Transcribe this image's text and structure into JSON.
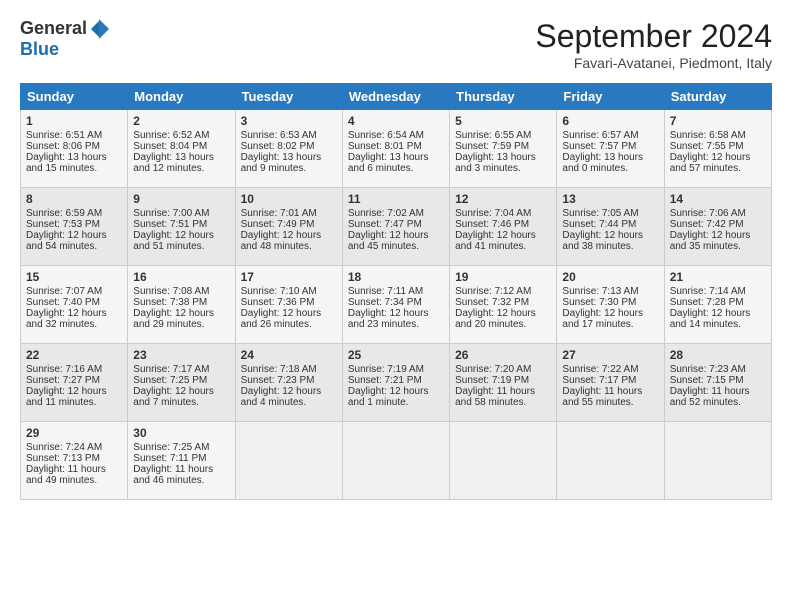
{
  "header": {
    "logo_general": "General",
    "logo_blue": "Blue",
    "title": "September 2024",
    "subtitle": "Favari-Avatanei, Piedmont, Italy"
  },
  "weekdays": [
    "Sunday",
    "Monday",
    "Tuesday",
    "Wednesday",
    "Thursday",
    "Friday",
    "Saturday"
  ],
  "weeks": [
    [
      {
        "day": "1",
        "lines": [
          "Sunrise: 6:51 AM",
          "Sunset: 8:06 PM",
          "Daylight: 13 hours",
          "and 15 minutes."
        ]
      },
      {
        "day": "2",
        "lines": [
          "Sunrise: 6:52 AM",
          "Sunset: 8:04 PM",
          "Daylight: 13 hours",
          "and 12 minutes."
        ]
      },
      {
        "day": "3",
        "lines": [
          "Sunrise: 6:53 AM",
          "Sunset: 8:02 PM",
          "Daylight: 13 hours",
          "and 9 minutes."
        ]
      },
      {
        "day": "4",
        "lines": [
          "Sunrise: 6:54 AM",
          "Sunset: 8:01 PM",
          "Daylight: 13 hours",
          "and 6 minutes."
        ]
      },
      {
        "day": "5",
        "lines": [
          "Sunrise: 6:55 AM",
          "Sunset: 7:59 PM",
          "Daylight: 13 hours",
          "and 3 minutes."
        ]
      },
      {
        "day": "6",
        "lines": [
          "Sunrise: 6:57 AM",
          "Sunset: 7:57 PM",
          "Daylight: 13 hours",
          "and 0 minutes."
        ]
      },
      {
        "day": "7",
        "lines": [
          "Sunrise: 6:58 AM",
          "Sunset: 7:55 PM",
          "Daylight: 12 hours",
          "and 57 minutes."
        ]
      }
    ],
    [
      {
        "day": "8",
        "lines": [
          "Sunrise: 6:59 AM",
          "Sunset: 7:53 PM",
          "Daylight: 12 hours",
          "and 54 minutes."
        ]
      },
      {
        "day": "9",
        "lines": [
          "Sunrise: 7:00 AM",
          "Sunset: 7:51 PM",
          "Daylight: 12 hours",
          "and 51 minutes."
        ]
      },
      {
        "day": "10",
        "lines": [
          "Sunrise: 7:01 AM",
          "Sunset: 7:49 PM",
          "Daylight: 12 hours",
          "and 48 minutes."
        ]
      },
      {
        "day": "11",
        "lines": [
          "Sunrise: 7:02 AM",
          "Sunset: 7:47 PM",
          "Daylight: 12 hours",
          "and 45 minutes."
        ]
      },
      {
        "day": "12",
        "lines": [
          "Sunrise: 7:04 AM",
          "Sunset: 7:46 PM",
          "Daylight: 12 hours",
          "and 41 minutes."
        ]
      },
      {
        "day": "13",
        "lines": [
          "Sunrise: 7:05 AM",
          "Sunset: 7:44 PM",
          "Daylight: 12 hours",
          "and 38 minutes."
        ]
      },
      {
        "day": "14",
        "lines": [
          "Sunrise: 7:06 AM",
          "Sunset: 7:42 PM",
          "Daylight: 12 hours",
          "and 35 minutes."
        ]
      }
    ],
    [
      {
        "day": "15",
        "lines": [
          "Sunrise: 7:07 AM",
          "Sunset: 7:40 PM",
          "Daylight: 12 hours",
          "and 32 minutes."
        ]
      },
      {
        "day": "16",
        "lines": [
          "Sunrise: 7:08 AM",
          "Sunset: 7:38 PM",
          "Daylight: 12 hours",
          "and 29 minutes."
        ]
      },
      {
        "day": "17",
        "lines": [
          "Sunrise: 7:10 AM",
          "Sunset: 7:36 PM",
          "Daylight: 12 hours",
          "and 26 minutes."
        ]
      },
      {
        "day": "18",
        "lines": [
          "Sunrise: 7:11 AM",
          "Sunset: 7:34 PM",
          "Daylight: 12 hours",
          "and 23 minutes."
        ]
      },
      {
        "day": "19",
        "lines": [
          "Sunrise: 7:12 AM",
          "Sunset: 7:32 PM",
          "Daylight: 12 hours",
          "and 20 minutes."
        ]
      },
      {
        "day": "20",
        "lines": [
          "Sunrise: 7:13 AM",
          "Sunset: 7:30 PM",
          "Daylight: 12 hours",
          "and 17 minutes."
        ]
      },
      {
        "day": "21",
        "lines": [
          "Sunrise: 7:14 AM",
          "Sunset: 7:28 PM",
          "Daylight: 12 hours",
          "and 14 minutes."
        ]
      }
    ],
    [
      {
        "day": "22",
        "lines": [
          "Sunrise: 7:16 AM",
          "Sunset: 7:27 PM",
          "Daylight: 12 hours",
          "and 11 minutes."
        ]
      },
      {
        "day": "23",
        "lines": [
          "Sunrise: 7:17 AM",
          "Sunset: 7:25 PM",
          "Daylight: 12 hours",
          "and 7 minutes."
        ]
      },
      {
        "day": "24",
        "lines": [
          "Sunrise: 7:18 AM",
          "Sunset: 7:23 PM",
          "Daylight: 12 hours",
          "and 4 minutes."
        ]
      },
      {
        "day": "25",
        "lines": [
          "Sunrise: 7:19 AM",
          "Sunset: 7:21 PM",
          "Daylight: 12 hours",
          "and 1 minute."
        ]
      },
      {
        "day": "26",
        "lines": [
          "Sunrise: 7:20 AM",
          "Sunset: 7:19 PM",
          "Daylight: 11 hours",
          "and 58 minutes."
        ]
      },
      {
        "day": "27",
        "lines": [
          "Sunrise: 7:22 AM",
          "Sunset: 7:17 PM",
          "Daylight: 11 hours",
          "and 55 minutes."
        ]
      },
      {
        "day": "28",
        "lines": [
          "Sunrise: 7:23 AM",
          "Sunset: 7:15 PM",
          "Daylight: 11 hours",
          "and 52 minutes."
        ]
      }
    ],
    [
      {
        "day": "29",
        "lines": [
          "Sunrise: 7:24 AM",
          "Sunset: 7:13 PM",
          "Daylight: 11 hours",
          "and 49 minutes."
        ]
      },
      {
        "day": "30",
        "lines": [
          "Sunrise: 7:25 AM",
          "Sunset: 7:11 PM",
          "Daylight: 11 hours",
          "and 46 minutes."
        ]
      },
      {
        "day": "",
        "lines": []
      },
      {
        "day": "",
        "lines": []
      },
      {
        "day": "",
        "lines": []
      },
      {
        "day": "",
        "lines": []
      },
      {
        "day": "",
        "lines": []
      }
    ]
  ]
}
